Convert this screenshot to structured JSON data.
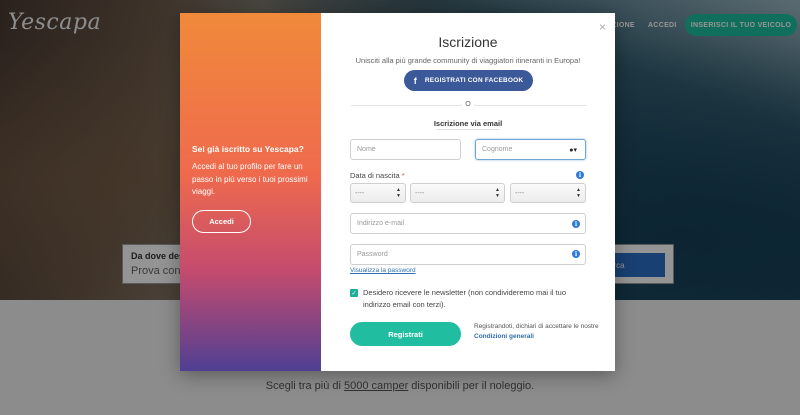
{
  "background": {
    "logo": "Yescapa",
    "nav": {
      "partial_item": "ZIONE",
      "login": "ACCEDI",
      "cta": "INSERISCI IL TUO VEICOLO"
    },
    "search": {
      "title": "Da dove desi",
      "subtitle": "Prova con «",
      "button": "rca"
    },
    "tagline": {
      "prefix": "Scegli tra più di ",
      "count": "5000 camper",
      "suffix": " disponibili per il noleggio."
    }
  },
  "modal_left": {
    "title": "Sei già iscritto su Yescapa?",
    "text": "Accedi al tuo profilo per fare un passo in più verso i tuoi prossimi viaggi.",
    "button": "Accedi"
  },
  "modal_right": {
    "close": "×",
    "title": "Iscrizione",
    "subtitle": "Unisciti alla più grande community di viaggiatori itineranti in Europa!",
    "facebook_button": "REGISTRATI CON FACEBOOK",
    "divider_text": "O",
    "email_section": "Iscrizione via email",
    "first_name_placeholder": "Nome",
    "last_name_placeholder": "Cognome",
    "dob_label": "Data di nascita",
    "dob_required": "*",
    "dob_day": "----",
    "dob_month": "----",
    "dob_year": "----",
    "email_placeholder": "Indirizzo e-mail",
    "password_placeholder": "Password",
    "show_password": "Visualizza la password",
    "newsletter": "Desidero ricevere le newsletter (non condivideremo mai il tuo indirizzo email con terzi).",
    "register_button": "Registrati",
    "terms_prefix": "Registrandoti, dichiari di accettare le nostre ",
    "terms_link": "Condizioni generali"
  },
  "colors": {
    "accent": "#21bda0",
    "facebook": "#3b5998",
    "info": "#2f7ad6"
  }
}
